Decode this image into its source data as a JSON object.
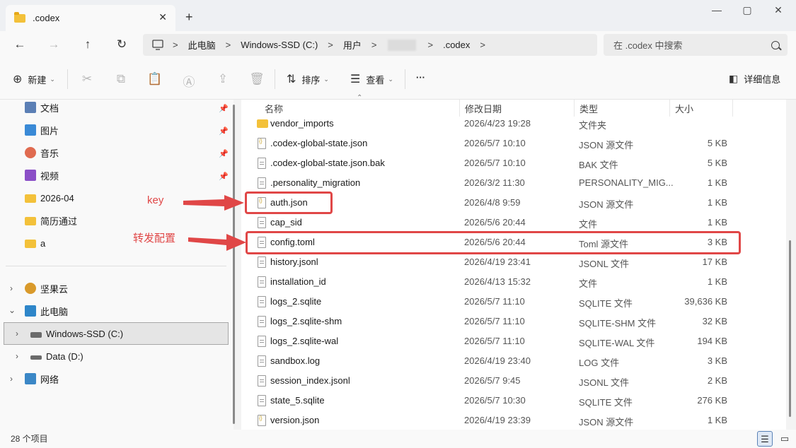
{
  "tab": {
    "title": ".codex",
    "close": "✕",
    "new_tab": "+"
  },
  "window_controls": {
    "minimize": "—",
    "maximize": "▢",
    "close": "✕"
  },
  "nav": {
    "back": "←",
    "forward": "→",
    "up": "↑",
    "refresh": "↻"
  },
  "breadcrumb": [
    "此电脑",
    "Windows-SSD (C:)",
    "用户",
    ".codex"
  ],
  "breadcrumb_sep": ">",
  "search": {
    "placeholder": "在 .codex 中搜索"
  },
  "toolbar": {
    "new_label": "新建",
    "sort_label": "排序",
    "view_label": "查看",
    "more_label": "···",
    "details_label": "详细信息"
  },
  "sidebar": {
    "quick_access": [
      {
        "label": "文档",
        "icon": "document-icon",
        "color": "#5b7fb5",
        "pinned": true
      },
      {
        "label": "图片",
        "icon": "pictures-icon",
        "color": "#3a8ad6",
        "pinned": true
      },
      {
        "label": "音乐",
        "icon": "music-icon",
        "color": "#e06b50",
        "pinned": true
      },
      {
        "label": "视频",
        "icon": "video-icon",
        "color": "#8b4fc7",
        "pinned": true
      },
      {
        "label": "2026-04",
        "icon": "folder-icon",
        "color": "#f3c13a",
        "pinned": false
      },
      {
        "label": "简历通过",
        "icon": "folder-icon",
        "color": "#f3c13a",
        "pinned": false
      },
      {
        "label": "a",
        "icon": "folder-icon",
        "color": "#f3c13a",
        "pinned": false
      }
    ],
    "tree": [
      {
        "label": "坚果云",
        "icon": "nutstore-icon"
      },
      {
        "label": "此电脑",
        "icon": "computer-icon"
      },
      {
        "label": "Windows-SSD (C:)",
        "icon": "drive-icon"
      },
      {
        "label": "Data (D:)",
        "icon": "drive-icon"
      },
      {
        "label": "网络",
        "icon": "network-icon"
      }
    ],
    "pin_glyph": "📌"
  },
  "columns": {
    "name": "名称",
    "date": "修改日期",
    "type": "类型",
    "size": "大小"
  },
  "files": [
    {
      "name": "vendor_imports",
      "date": "2026/4/23 19:28",
      "type": "文件夹",
      "size": "",
      "icon": "folder"
    },
    {
      "name": ".codex-global-state.json",
      "date": "2026/5/7 10:10",
      "type": "JSON 源文件",
      "size": "5 KB",
      "icon": "json"
    },
    {
      "name": ".codex-global-state.json.bak",
      "date": "2026/5/7 10:10",
      "type": "BAK 文件",
      "size": "5 KB",
      "icon": "txt"
    },
    {
      "name": ".personality_migration",
      "date": "2026/3/2 11:30",
      "type": "PERSONALITY_MIG...",
      "size": "1 KB",
      "icon": "txt"
    },
    {
      "name": "auth.json",
      "date": "2026/4/8 9:59",
      "type": "JSON 源文件",
      "size": "1 KB",
      "icon": "json"
    },
    {
      "name": "cap_sid",
      "date": "2026/5/6 20:44",
      "type": "文件",
      "size": "1 KB",
      "icon": "txt"
    },
    {
      "name": "config.toml",
      "date": "2026/5/6 20:44",
      "type": "Toml 源文件",
      "size": "3 KB",
      "icon": "txt"
    },
    {
      "name": "history.jsonl",
      "date": "2026/4/19 23:41",
      "type": "JSONL 文件",
      "size": "17 KB",
      "icon": "txt"
    },
    {
      "name": "installation_id",
      "date": "2026/4/13 15:32",
      "type": "文件",
      "size": "1 KB",
      "icon": "txt"
    },
    {
      "name": "logs_2.sqlite",
      "date": "2026/5/7 11:10",
      "type": "SQLITE 文件",
      "size": "39,636 KB",
      "icon": "txt"
    },
    {
      "name": "logs_2.sqlite-shm",
      "date": "2026/5/7 11:10",
      "type": "SQLITE-SHM 文件",
      "size": "32 KB",
      "icon": "txt"
    },
    {
      "name": "logs_2.sqlite-wal",
      "date": "2026/5/7 11:10",
      "type": "SQLITE-WAL 文件",
      "size": "194 KB",
      "icon": "txt"
    },
    {
      "name": "sandbox.log",
      "date": "2026/4/19 23:40",
      "type": "LOG 文件",
      "size": "3 KB",
      "icon": "txt"
    },
    {
      "name": "session_index.jsonl",
      "date": "2026/5/7 9:45",
      "type": "JSONL 文件",
      "size": "2 KB",
      "icon": "txt"
    },
    {
      "name": "state_5.sqlite",
      "date": "2026/5/7 10:30",
      "type": "SQLITE 文件",
      "size": "276 KB",
      "icon": "txt"
    },
    {
      "name": "version.json",
      "date": "2026/4/19 23:39",
      "type": "JSON 源文件",
      "size": "1 KB",
      "icon": "json"
    }
  ],
  "annotations": {
    "key_label": "key",
    "config_label": "转发配置",
    "color": "#e04747"
  },
  "status": {
    "item_count": "28 个项目"
  }
}
